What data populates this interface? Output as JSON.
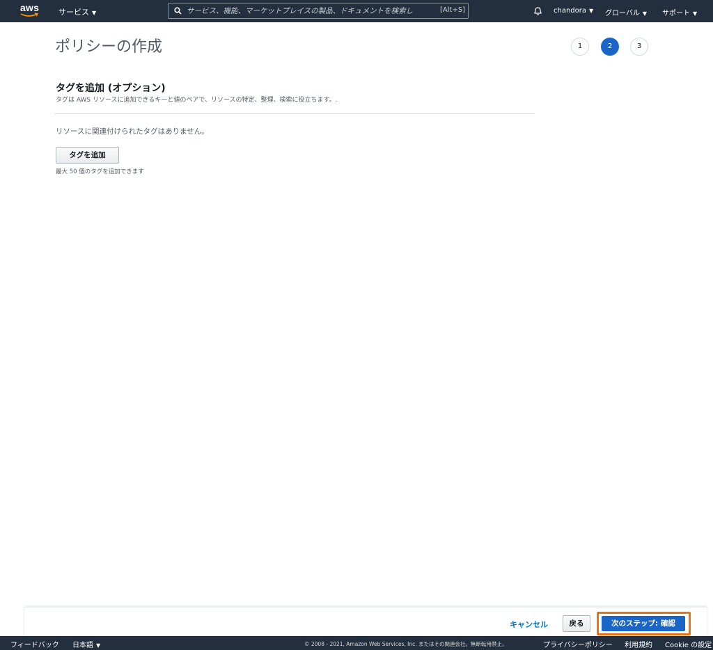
{
  "header": {
    "logo_text": "aws",
    "services_label": "サービス",
    "search_placeholder": "サービス、機能、マーケットプレイスの製品、ドキュメントを検索し",
    "search_shortcut": "[Alt+S]",
    "user_label": "chandora",
    "region_label": "グローバル",
    "support_label": "サポート",
    "icons": [
      "aws-logo",
      "search-icon",
      "bell-icon",
      "caret-down-icon"
    ]
  },
  "page": {
    "title": "ポリシーの作成",
    "steps": [
      {
        "label": "1",
        "active": false
      },
      {
        "label": "2",
        "active": true
      },
      {
        "label": "3",
        "active": false
      }
    ],
    "accent_color": "#1a66c8"
  },
  "tags": {
    "heading": "タグを追加 (オプション)",
    "description": "タグは AWS リソースに追加できるキーと値のペアで、リソースの特定、整理、検索に役立ちます。.",
    "empty_message": "リソースに関連付けられたタグはありません。",
    "add_button": "タグを追加",
    "limit_text": "最大 50 個のタグを追加できます"
  },
  "actions": {
    "cancel": "キャンセル",
    "back": "戻る",
    "next": "次のステップ: 確認",
    "highlight_color": "#ec7211"
  },
  "footer": {
    "feedback": "フィードバック",
    "language": "日本語",
    "copyright": "© 2008 - 2021, Amazon Web Services, Inc. またはその関連会社。無断転用禁止。",
    "privacy": "プライバシーポリシー",
    "terms": "利用規約",
    "cookie": "Cookie の設定"
  }
}
